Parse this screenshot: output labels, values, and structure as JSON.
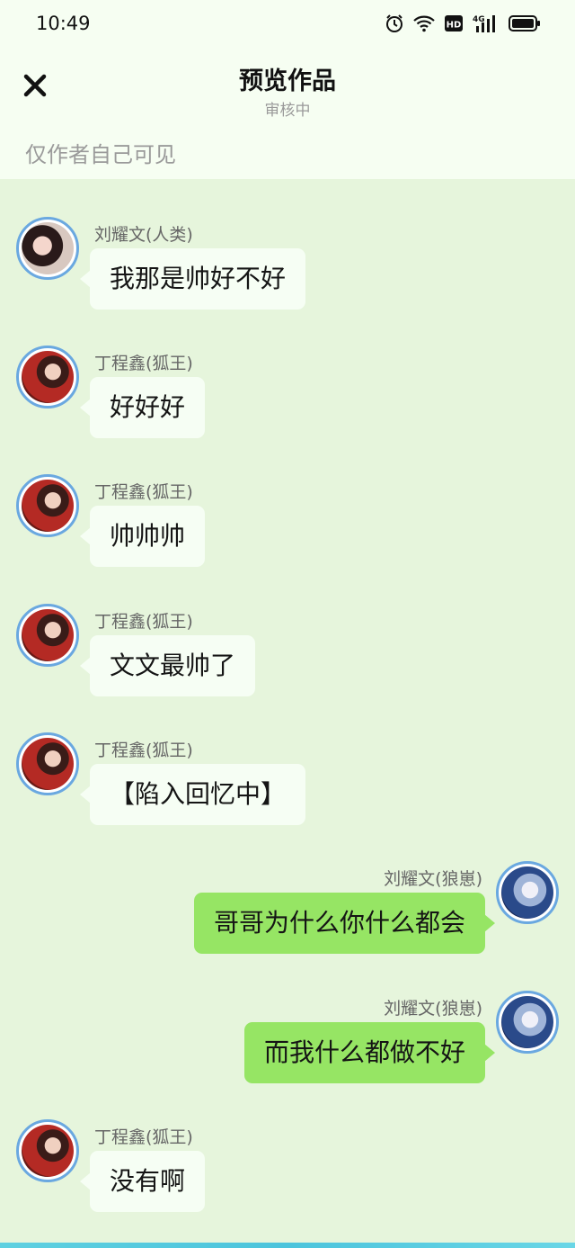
{
  "status_bar": {
    "time": "10:49",
    "icons": [
      "alarm-icon",
      "wifi-icon",
      "hd-icon",
      "cellular-4g-icon",
      "battery-icon"
    ],
    "hd_label": "HD",
    "network_label": "4G"
  },
  "header": {
    "close_icon": "close-icon",
    "title": "预览作品",
    "subtitle": "审核中",
    "visibility_note": "仅作者自己可见"
  },
  "colors": {
    "background": "#e6f5dc",
    "header_background": "#f6fef2",
    "left_bubble": "#f6fef4",
    "right_bubble": "#96e564",
    "avatar_border": "#6aa8e0"
  },
  "messages": [
    {
      "side": "left",
      "avatar": "avatar-human",
      "name": "刘耀文(人类)",
      "text": "我那是帅好不好"
    },
    {
      "side": "left",
      "avatar": "avatar-fox",
      "name": "丁程鑫(狐王)",
      "text": "好好好"
    },
    {
      "side": "left",
      "avatar": "avatar-fox",
      "name": "丁程鑫(狐王)",
      "text": "帅帅帅"
    },
    {
      "side": "left",
      "avatar": "avatar-fox",
      "name": "丁程鑫(狐王)",
      "text": "文文最帅了"
    },
    {
      "side": "left",
      "avatar": "avatar-fox",
      "name": "丁程鑫(狐王)",
      "text": "【陷入回忆中】"
    },
    {
      "side": "right",
      "avatar": "avatar-wolf",
      "name": "刘耀文(狼崽)",
      "text": "哥哥为什么你什么都会"
    },
    {
      "side": "right",
      "avatar": "avatar-wolf",
      "name": "刘耀文(狼崽)",
      "text": "而我什么都做不好"
    },
    {
      "side": "left",
      "avatar": "avatar-fox",
      "name": "丁程鑫(狐王)",
      "text": "没有啊"
    }
  ]
}
